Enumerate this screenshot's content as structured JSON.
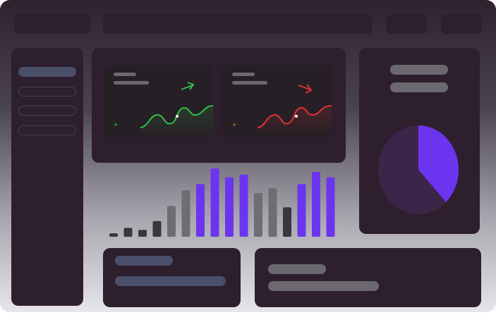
{
  "window": {
    "title": ""
  },
  "toolbar": {
    "menu": "",
    "search": "",
    "action1": "",
    "action2": ""
  },
  "sidebar": {
    "items": [
      "",
      "",
      "",
      ""
    ],
    "active_index": 0
  },
  "cards": [
    {
      "title": "",
      "subtitle": "",
      "trend": "up",
      "trend_color": "#2fbf4a",
      "icon": "arrow-up-right-icon"
    },
    {
      "title": "",
      "subtitle": "",
      "trend": "down",
      "trend_color": "#e03333",
      "icon": "arrow-down-right-icon"
    }
  ],
  "colors": {
    "accent": "#6b35f0",
    "panel": "#2e1f2e",
    "pie_bg": "#3b2548",
    "bar_gray": "#6f6c72",
    "bar_dark": "#3a363c"
  },
  "chart_data": [
    {
      "type": "bar",
      "categories": [
        "",
        "",
        "",
        "",
        "",
        "",
        "",
        "",
        "",
        "",
        "",
        "",
        "",
        "",
        "",
        ""
      ],
      "series": [
        {
          "values": [
            5,
            13,
            10,
            23,
            45,
            68,
            77,
            100,
            87,
            91,
            64,
            71,
            43,
            77,
            95,
            87
          ]
        }
      ],
      "bar_colors": [
        "#3a363c",
        "#3a363c",
        "#3a363c",
        "#3a363c",
        "#6f6c72",
        "#6f6c72",
        "#6b35f0",
        "#6b35f0",
        "#6b35f0",
        "#6b35f0",
        "#6f6c72",
        "#6f6c72",
        "#3a363c",
        "#6b35f0",
        "#6b35f0",
        "#6b35f0"
      ],
      "ylim": [
        0,
        100
      ],
      "grid": false,
      "title": "",
      "xlabel": "",
      "ylabel": ""
    },
    {
      "type": "pie",
      "slices": [
        {
          "value": 38,
          "color": "#6b35f0"
        },
        {
          "value": 62,
          "color": "#3b2548"
        }
      ],
      "title": ""
    }
  ],
  "summary": {
    "left_title": "",
    "left_value": "",
    "right_title": "",
    "right_value": ""
  },
  "pie_panel": {
    "line1": "",
    "line2": ""
  }
}
